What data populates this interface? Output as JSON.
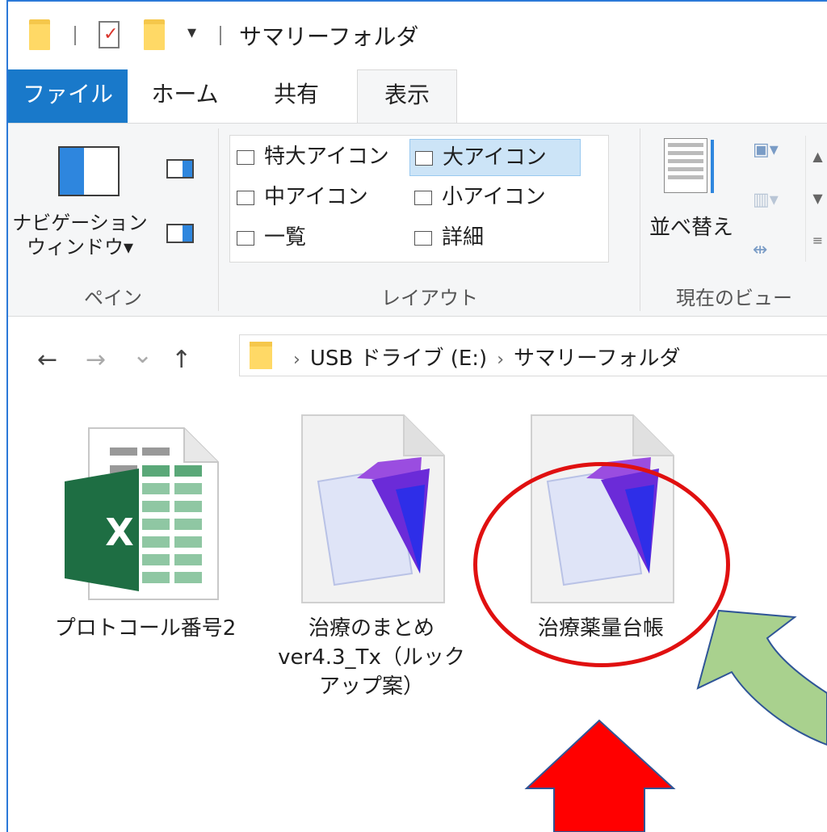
{
  "window": {
    "title": "サマリーフォルダ",
    "qa_dropdown": "▾"
  },
  "tabs": {
    "file": "ファイル",
    "home": "ホーム",
    "share": "共有",
    "view": "表示"
  },
  "ribbon": {
    "pane": {
      "nav_label_1": "ナビゲーション",
      "nav_label_2": "ウィンドウ▾",
      "group_label": "ペイン"
    },
    "layout": {
      "items": {
        "extra_large": "特大アイコン",
        "large": "大アイコン",
        "medium": "中アイコン",
        "small": "小アイコン",
        "list": "一覧",
        "details": "詳細"
      },
      "group_label": "レイアウト"
    },
    "current_view": {
      "sort_label": "並べ替え",
      "group_label": "現在のビュー"
    }
  },
  "navigation": {
    "back": "←",
    "forward": "→",
    "recent": "⌄",
    "up": "↑",
    "breadcrumb": {
      "drive": "USB ドライブ (E:)",
      "folder": "サマリーフォルダ"
    },
    "separator": "›"
  },
  "files": [
    {
      "name": "プロトコール番号2",
      "type": "excel-file-icon"
    },
    {
      "name_line1": "治療のまとめ",
      "name_line2": "ver4.3_Tx（ルック",
      "name_line3": "アップ案）",
      "type": "filemaker-file-icon"
    },
    {
      "name": "治療薬量台帳",
      "type": "filemaker-file-icon"
    }
  ],
  "excel_letter": "X",
  "annotations": {
    "circle_color": "#e01010",
    "red_arrow_color": "#ff0000",
    "green_arrow_color": "#a9d18e"
  }
}
